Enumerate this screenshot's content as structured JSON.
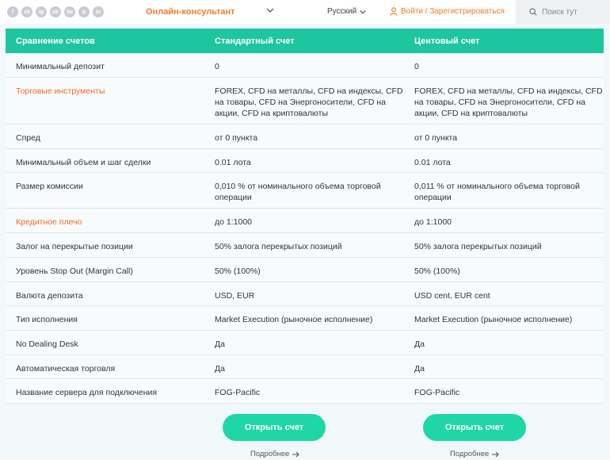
{
  "header": {
    "socials": [
      "f",
      "vk",
      "ig",
      "ok",
      "tw",
      "p",
      "in"
    ],
    "consultant_label": "Онлайн-консультант",
    "language_label": "Русский",
    "login_label": "Войти / Зарегистрироваться",
    "search_placeholder": "Поиск тут"
  },
  "table": {
    "columns": [
      "Сравнение счетов",
      "Стандартный счет",
      "Центовый счет"
    ],
    "rows": [
      {
        "label": "Минимальный депозит",
        "std": "0",
        "cent": "0"
      },
      {
        "label": "Торговые инструменты",
        "std": "FOREX, CFD на металлы, CFD на индексы, CFD на товары, CFD на Энергоносители, CFD на акции, CFD на криптовалюты",
        "cent": "FOREX, CFD на металлы, CFD на индексы, CFD на товары, CFD на Энергоносители, CFD на акции, CFD на криптовалюты"
      },
      {
        "label": "Спред",
        "std": "от 0 пункта",
        "cent": "от 0 пункта"
      },
      {
        "label": "Минимальный объем и шаг сделки",
        "std": "0.01 лота",
        "cent": "0.01 лота"
      },
      {
        "label": "Размер комиссии",
        "std": "0,010 % от номинального объема торговой операции",
        "cent": "0,011 % от номинального объема торговой операции"
      },
      {
        "label": "Кредитное плечо",
        "std": "до 1:1000",
        "cent": "до 1:1000"
      },
      {
        "label": "Залог на перекрытые позиции",
        "std": "50% залога перекрытых позиций",
        "cent": "50% залога перекрытых позиций"
      },
      {
        "label": "Уровень Stop Out (Margin Call)",
        "std": "50% (100%)",
        "cent": "50% (100%)"
      },
      {
        "label": "Валюта депозита",
        "std": "USD, EUR",
        "cent": "USD cent, EUR cent"
      },
      {
        "label": "Тип исполнения",
        "std": "Market Execution (рыночное исполнение)",
        "cent": "Market Execution (рыночное исполнение)"
      },
      {
        "label": "No Dealing Desk",
        "std": "Да",
        "cent": "Да"
      },
      {
        "label": "Автоматическая торговля",
        "std": "Да",
        "cent": "Да"
      },
      {
        "label": "Название сервера для подключения",
        "std": "FOG-Pacific",
        "cent": "FOG-Pacific"
      }
    ]
  },
  "actions": {
    "open_standard": "Открыть счет",
    "open_cent": "Открыть счет",
    "more_standard": "Подробнее",
    "more_cent": "Подробнее"
  },
  "colors": {
    "accent": "#1ec6a0",
    "button": "#1fd6a8",
    "orange": "#f56a2a"
  }
}
